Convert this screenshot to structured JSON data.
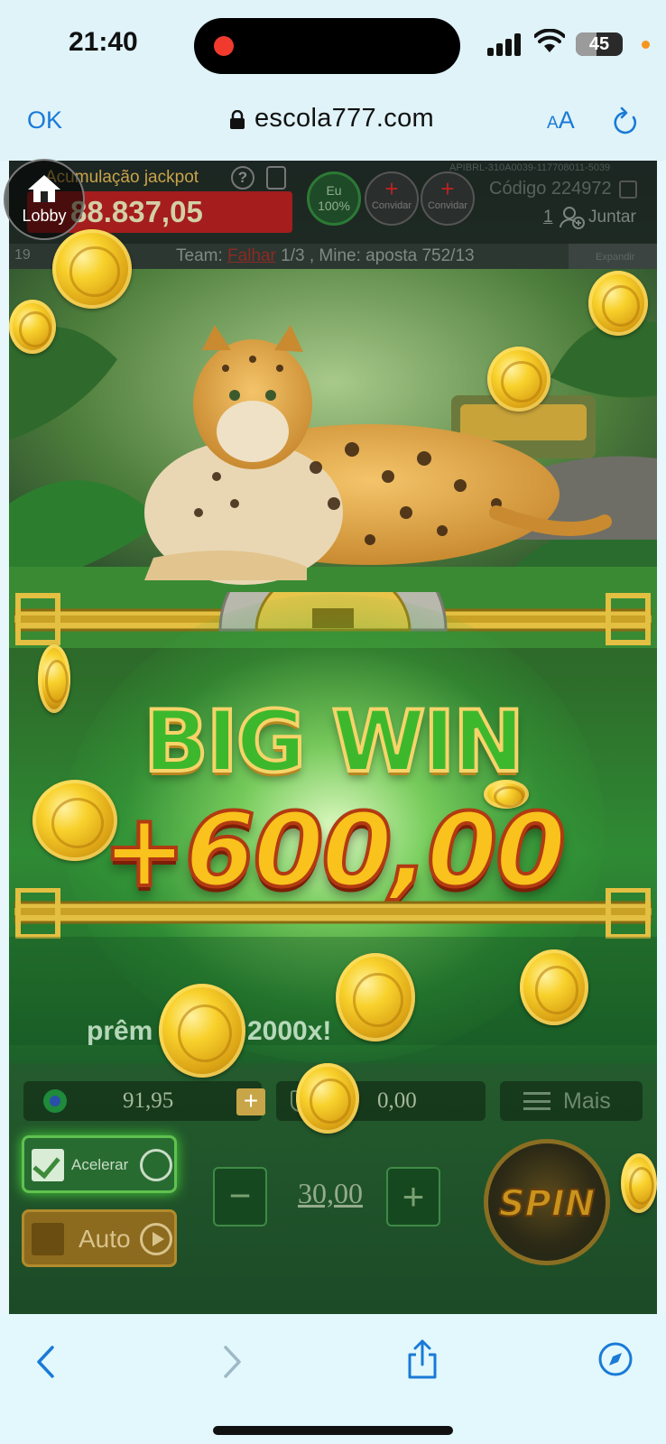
{
  "status_bar": {
    "time": "21:40",
    "battery": "45",
    "battery_level": 0.45
  },
  "browser": {
    "ok_label": "OK",
    "url": "escola777.com",
    "aa_small": "A",
    "aa_large": "A"
  },
  "game": {
    "lobby_label": "Lobby",
    "jackpot_label": "Acumulação jackpot",
    "jackpot_value": "88.837,05",
    "help_label": "?",
    "player_badge": {
      "name": "Eu",
      "percent": "100%"
    },
    "invite_label": "Convidar",
    "api_code": "APIBRL-310A0039-117708011-5039",
    "codigo": "Código 224972",
    "join_count": "1",
    "join_label": "Juntar",
    "team_left": "19",
    "team_prefix": "Team:",
    "team_status": "Falhar",
    "team_rest": "1/3 , Mine: aposta 752/13",
    "expand_label": "Expandir",
    "big_win": "BIG WIN",
    "win_amount": "+600,00",
    "premio_text": "prêm",
    "multiplier_text": "2000x!",
    "balance": "91,95",
    "balance_plus": "+",
    "last_win": "0,00",
    "more_label": "Mais",
    "accelerate_label": "Acelerar",
    "auto_label": "Auto",
    "bet_minus": "−",
    "bet_value": "30,00",
    "bet_plus": "+",
    "spin_label": "SPIN"
  }
}
